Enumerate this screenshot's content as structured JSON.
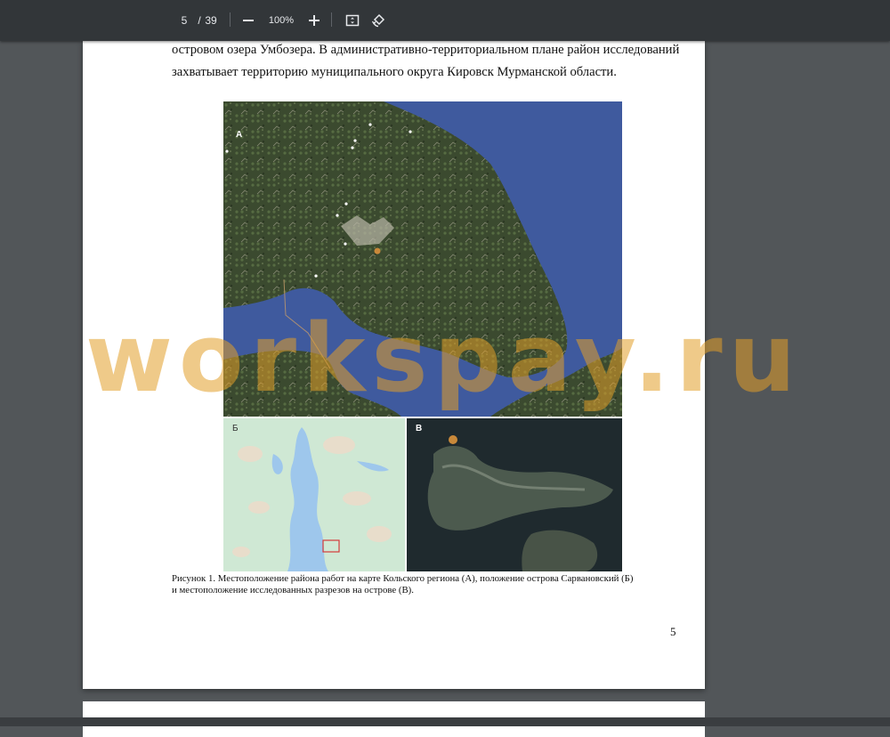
{
  "toolbar": {
    "page_current": "5",
    "page_separator": "/",
    "page_total": "39",
    "zoom_out_icon": "minus-icon",
    "zoom_value": "100%",
    "zoom_in_icon": "plus-icon",
    "fit_icon": "fit-page-icon",
    "rotate_icon": "rotate-icon"
  },
  "page": {
    "line1": "островом озера Умбозера. В административно-территориальном плане район исследований",
    "line2": "захватывает территорию муниципального округа Кировск Мурманской области.",
    "figure": {
      "label_a": "A",
      "label_b": "Б",
      "label_c": "B",
      "caption_line1": "Рисунок 1. Местоположение района работ на карте Кольского региона (А), положение острова Сарвановский (Б)",
      "caption_line2": "и местоположение исследованных разрезов на острове (В)."
    },
    "page_number": "5"
  },
  "watermark": "workspay.ru",
  "colors": {
    "viewer_bg": "#525659",
    "toolbar_bg": "#323639",
    "sea": "#3f5a9e",
    "land": "#3a4a2e",
    "map_bg_light": "#cfe8d4",
    "lake": "#9ec7ec",
    "watermark": "#e19e28"
  }
}
